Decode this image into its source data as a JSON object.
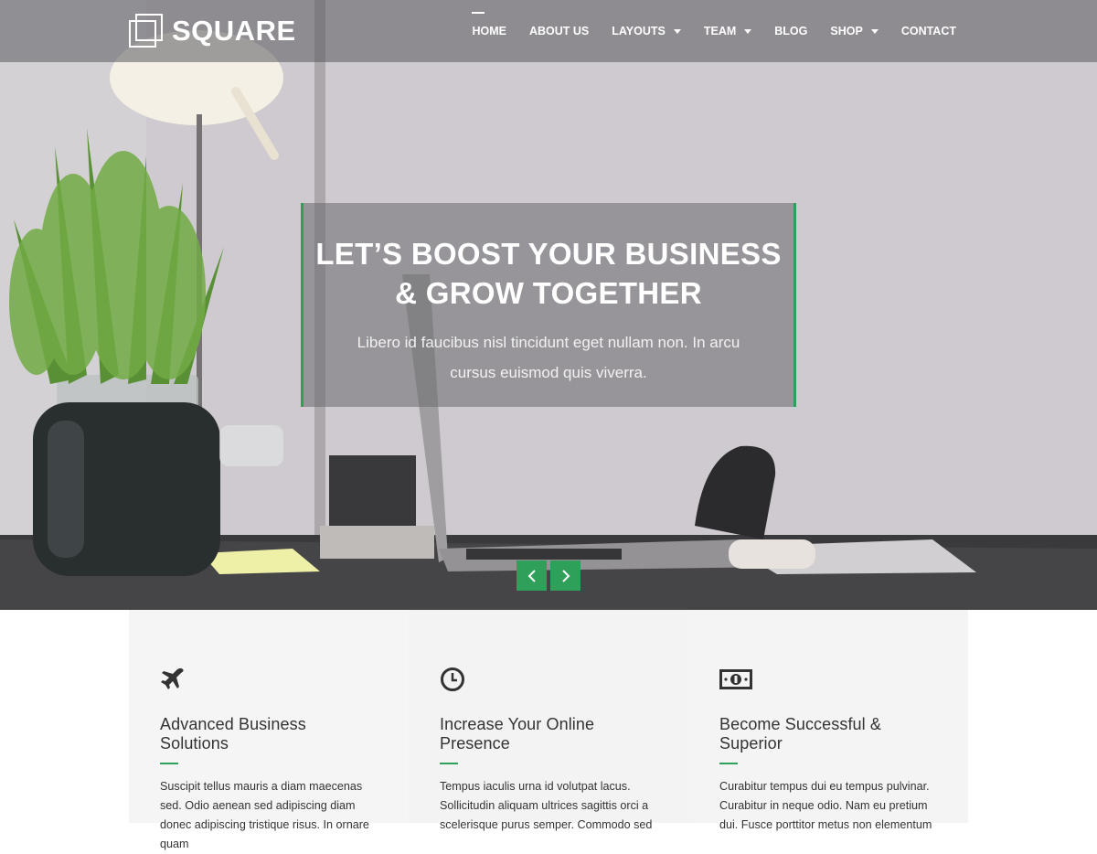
{
  "brand": {
    "name": "SQUARE"
  },
  "nav": {
    "items": [
      {
        "label": "HOME",
        "active": true,
        "dropdown": false
      },
      {
        "label": "ABOUT US",
        "active": false,
        "dropdown": false
      },
      {
        "label": "LAYOUTS",
        "active": false,
        "dropdown": true
      },
      {
        "label": "TEAM",
        "active": false,
        "dropdown": true
      },
      {
        "label": "BLOG",
        "active": false,
        "dropdown": false
      },
      {
        "label": "SHOP",
        "active": false,
        "dropdown": true
      },
      {
        "label": "CONTACT",
        "active": false,
        "dropdown": false
      }
    ]
  },
  "hero": {
    "title_line1": "LET’S BOOST YOUR BUSINESS",
    "title_line2": "& GROW TOGETHER",
    "subtitle": "Libero id faucibus nisl tincidunt eget nullam non. In arcu cursus euismod quis viverra.",
    "prev_icon": "chevron-left-icon",
    "next_icon": "chevron-right-icon"
  },
  "features": [
    {
      "icon": "airplane-icon",
      "title": "Advanced Business Solutions",
      "text": "Suscipit tellus mauris a diam maecenas sed. Odio aenean sed adipiscing diam donec adipiscing tristique risus. In ornare quam"
    },
    {
      "icon": "clock-icon",
      "title": "Increase Your Online Presence",
      "text": "Tempus iaculis urna id volutpat lacus. Sollicitudin aliquam ultrices sagittis orci a scelerisque purus semper. Commodo sed"
    },
    {
      "icon": "money-icon",
      "title": "Become Successful & Superior",
      "text": "Curabitur tempus dui eu tempus pulvinar. Curabitur in neque odio. Nam eu pretium dui. Fusce porttitor metus non elementum"
    }
  ],
  "colors": {
    "accent": "#2ea05a",
    "header_overlay": "#5a5a5f",
    "text": "#333333"
  }
}
